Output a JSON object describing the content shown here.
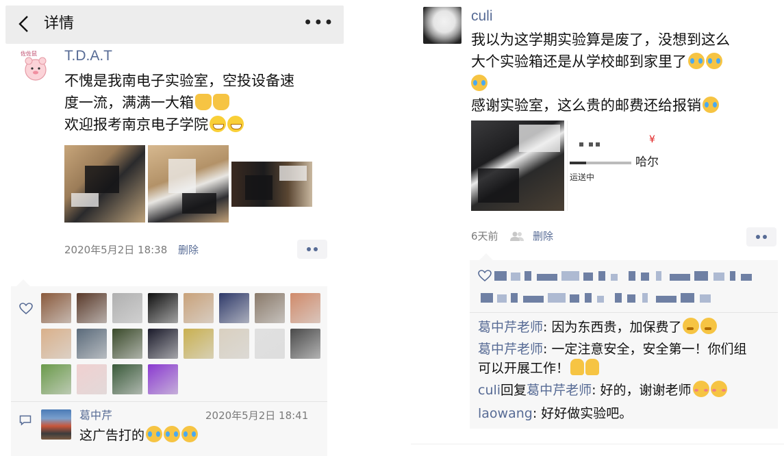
{
  "left": {
    "topbar": {
      "title": "详情",
      "more": "•••"
    },
    "post": {
      "author": "T.D.A.T",
      "avatar_label": "佐佐鼠",
      "line1": "不愧是我南电子实验室，空投设备速",
      "line2": "度一流，满满一大箱",
      "line3": "欢迎报考南京电子学院",
      "time": "2020年5月2日 18:38",
      "delete": "删除"
    },
    "likes": {
      "avatar_colors": [
        "#8a5a3c",
        "#5a3a2a",
        "#b0b0b0",
        "#101010",
        "#c9a27a",
        "#2f3a6a",
        "#8a7a6a",
        "#d08a6a",
        "#d9b08a",
        "#5a6a7a",
        "#3a4a2a",
        "#1a1a2a",
        "#c9b050",
        "#d9d0c0",
        "#e0e0e0",
        "#4a4a4a",
        "#6a9a4a",
        "#f0d0d0",
        "#3a5a3a",
        "#8a3ad0"
      ]
    },
    "comment": {
      "author": "葛中芹",
      "time": "2020年5月2日 18:41",
      "text": "这广告打的"
    }
  },
  "right": {
    "post": {
      "author": "culi",
      "line1": "我以为这学期实验算是废了，没想到这么",
      "line2": "大个实验箱还是从学校邮到家里了",
      "line3": "感谢实验室，这么贵的邮费还给报销",
      "shipping": {
        "city": "哈尔",
        "status": "运送中",
        "yen": "¥"
      },
      "time": "6天前",
      "delete": "删除"
    },
    "comments": [
      {
        "who": "葛中芹老师",
        "sep": ": ",
        "text": "因为东西贵，加保费了"
      },
      {
        "who": "葛中芹老师",
        "sep": ": ",
        "text": "一定注意安全，安全第一！你们组可以开展工作！"
      },
      {
        "who": "culi",
        "reply": "回复",
        "who2": "葛中芹老师",
        "sep": ": ",
        "text": "好的，谢谢老师"
      },
      {
        "who": "laowang",
        "sep": ": ",
        "text": "好好做实验吧。"
      }
    ]
  }
}
